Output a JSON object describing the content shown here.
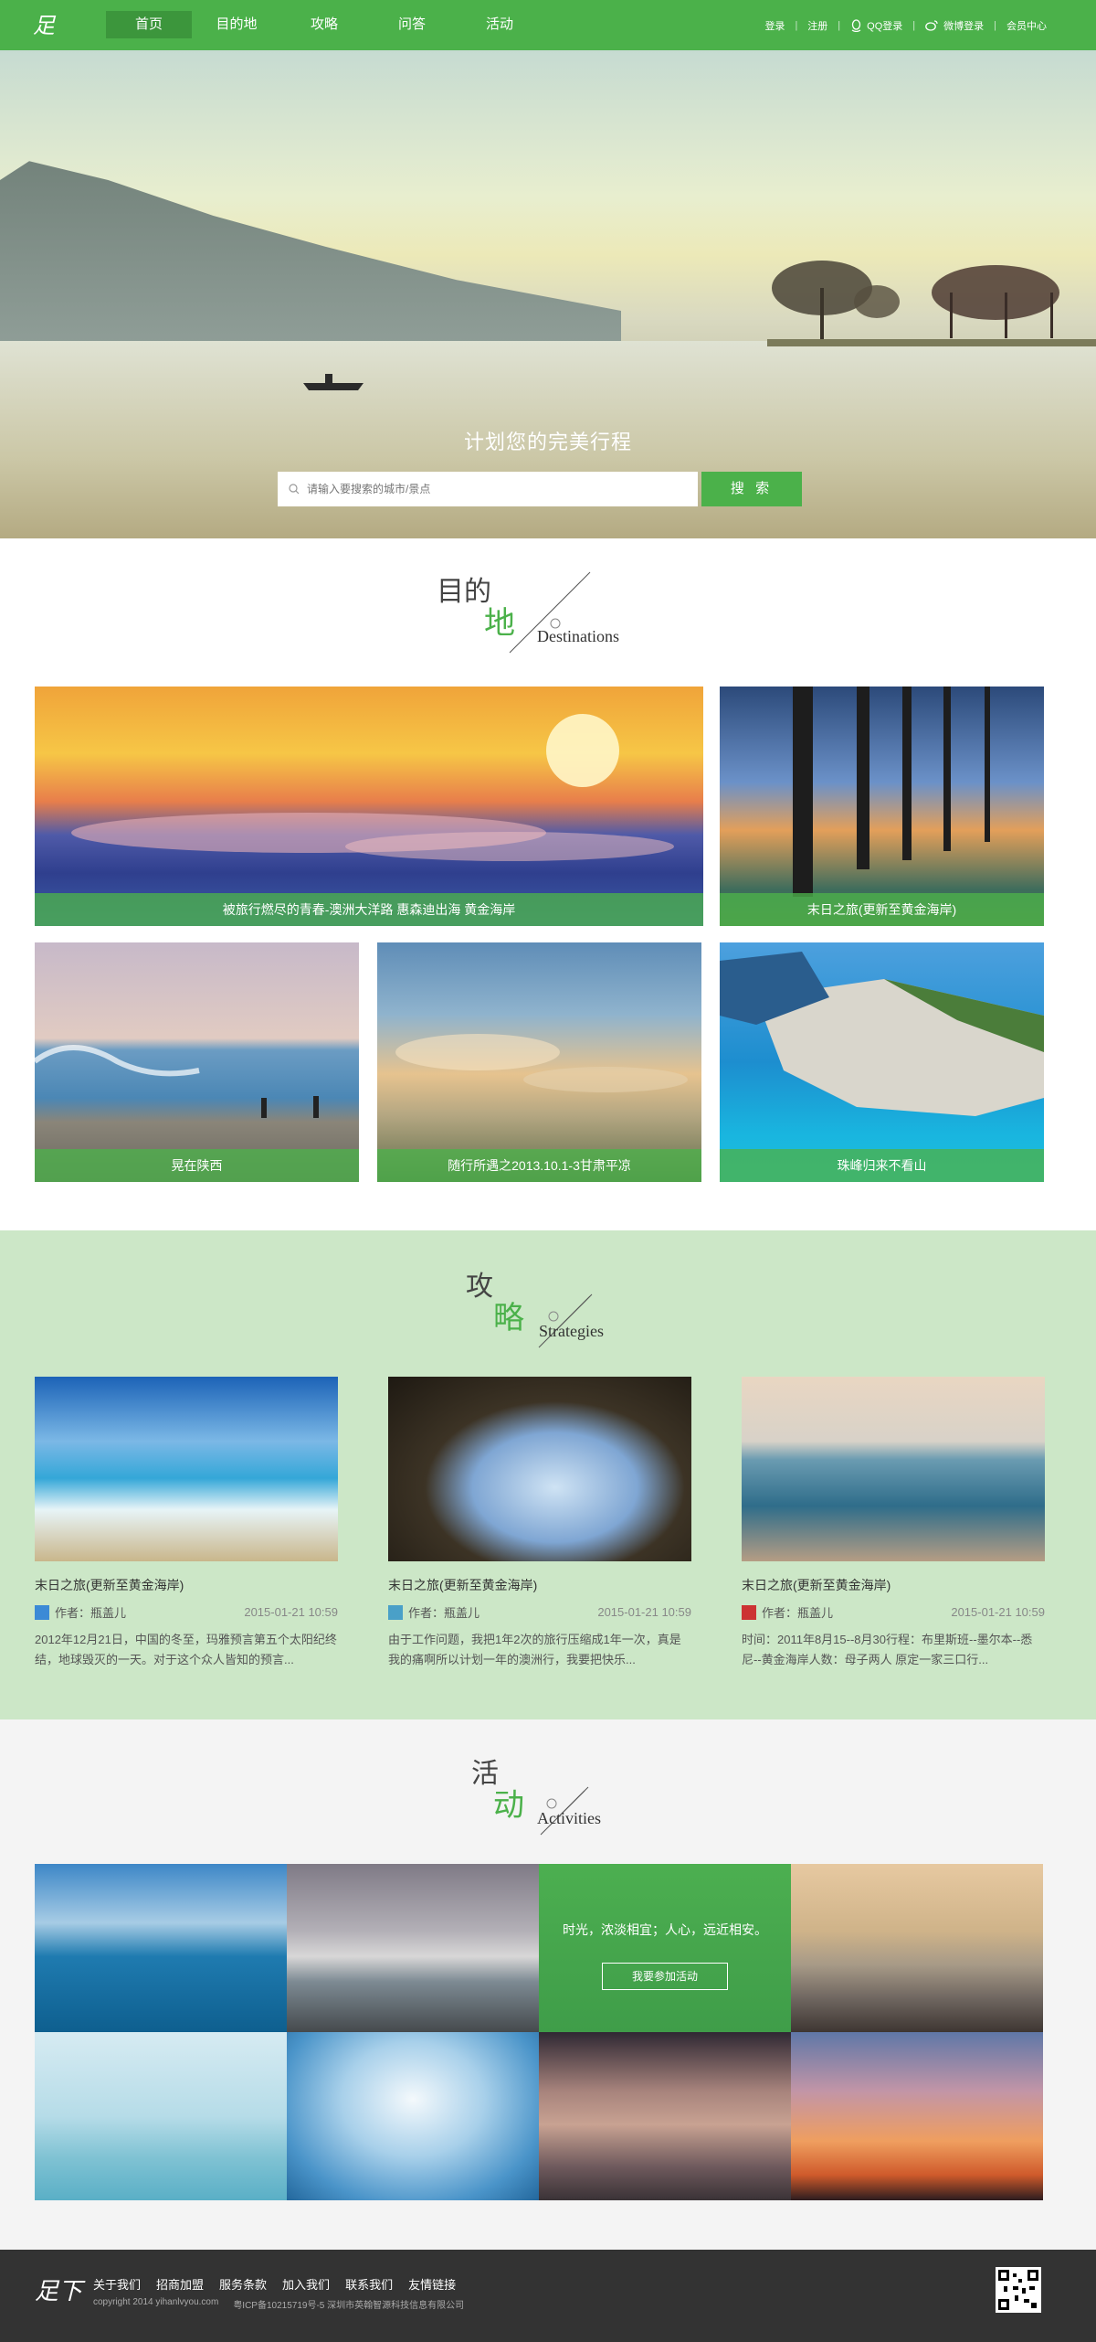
{
  "nav": {
    "logo": "足下",
    "items": [
      {
        "label": "首页"
      },
      {
        "label": "目的地"
      },
      {
        "label": "攻略"
      },
      {
        "label": "问答"
      },
      {
        "label": "活动"
      }
    ],
    "login": "登录",
    "register": "注册",
    "qq_login": "QQ登录",
    "weibo_login": "微博登录",
    "member": "会员中心"
  },
  "hero": {
    "title": "计划您的完美行程",
    "search_placeholder": "请输入要搜索的城市/景点",
    "search_button": "搜 索"
  },
  "destinations": {
    "title_a": "目的",
    "title_b": "地",
    "title_en": "Destinations",
    "items": [
      {
        "caption": "被旅行燃尽的青春-澳洲大洋路 惠森迪出海 黄金海岸"
      },
      {
        "caption": "末日之旅(更新至黄金海岸)"
      },
      {
        "caption": "晃在陕西"
      },
      {
        "caption": "随行所遇之2013.10.1-3甘肃平凉"
      },
      {
        "caption": "珠峰归来不看山"
      }
    ]
  },
  "strategies": {
    "title_a": "攻",
    "title_b": "略",
    "title_en": "Strategies",
    "items": [
      {
        "title": "末日之旅(更新至黄金海岸)",
        "author": "作者：瓶盖儿",
        "date": "2015-01-21 10:59",
        "desc": "2012年12月21日，中国的冬至，玛雅预言第五个太阳纪终结，地球毁灭的一天。对于这个众人皆知的预言..."
      },
      {
        "title": "末日之旅(更新至黄金海岸)",
        "author": "作者：瓶盖儿",
        "date": "2015-01-21 10:59",
        "desc": "由于工作问题，我把1年2次的旅行压缩成1年一次，真是我的痛啊所以计划一年的澳洲行，我要把快乐..."
      },
      {
        "title": "末日之旅(更新至黄金海岸)",
        "author": "作者：瓶盖儿",
        "date": "2015-01-21 10:59",
        "desc": "时间：2011年8月15--8月30行程：布里斯班--墨尔本--悉尼--黄金海岸人数：母子两人 原定一家三口行..."
      }
    ]
  },
  "activities": {
    "title_a": "活",
    "title_b": "动",
    "title_en": "Activities",
    "promo_text": "时光，浓淡相宜；人心，远近相安。",
    "promo_button": "我要参加活动"
  },
  "footer": {
    "logo": "足下",
    "links": [
      {
        "label": "关于我们"
      },
      {
        "label": "招商加盟"
      },
      {
        "label": "服务条款"
      },
      {
        "label": "加入我们"
      },
      {
        "label": "联系我们"
      },
      {
        "label": "友情链接"
      }
    ],
    "copyright": "copyright 2014 yihanlvyou.com",
    "icp": "粤ICP备10215719号-5  深圳市英翰智源科技信息有限公司"
  },
  "colors": {
    "brand": "#4bb14a",
    "brand_dark": "#3c963c",
    "strategy_bg": "#cce7c7",
    "footer_bg": "#333333"
  }
}
